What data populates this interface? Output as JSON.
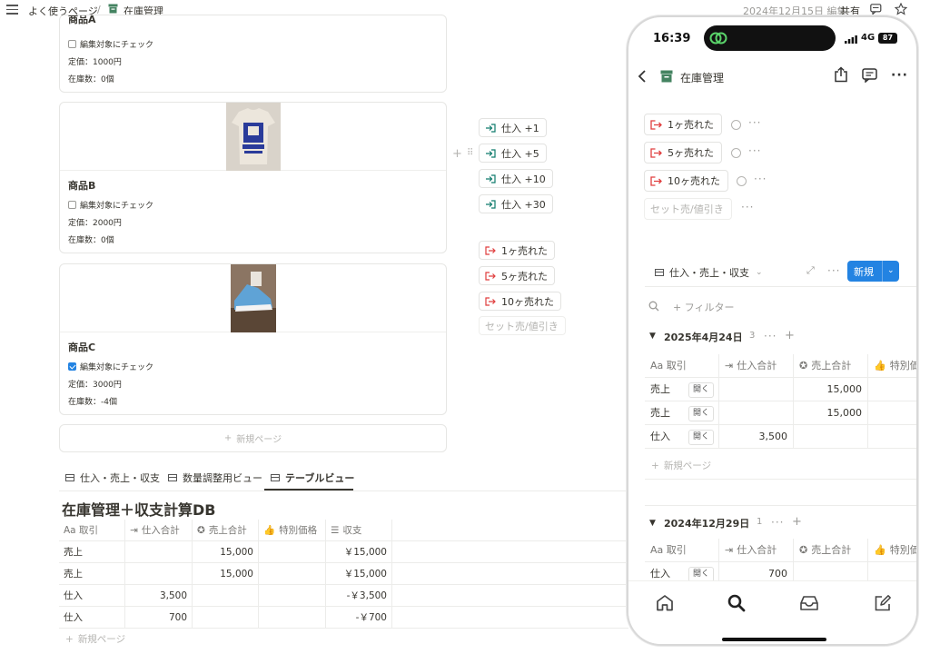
{
  "topbar": {
    "breadcrumb_parent": "よく使うページ",
    "breadcrumb_sep": "/",
    "breadcrumb_current": "在庫管理",
    "edited": "2024年12月15日 編集",
    "share": "共有"
  },
  "cards": [
    {
      "title": "商品A",
      "checkbox_label": "編集対象にチェック",
      "checked": false,
      "price": "定価：1000円",
      "stock": "在庫数：0個"
    },
    {
      "title": "商品B",
      "checkbox_label": "編集対象にチェック",
      "checked": false,
      "price": "定価：2000円",
      "stock": "在庫数：0個"
    },
    {
      "title": "商品C",
      "checkbox_label": "編集対象にチェック",
      "checked": true,
      "price": "定価：3000円",
      "stock": "在庫数：-4個"
    }
  ],
  "new_page": "新規ページ",
  "buy_buttons": [
    "仕入 +1",
    "仕入 +5",
    "仕入 +10",
    "仕入 +30"
  ],
  "sell_buttons": [
    "1ヶ売れた",
    "5ヶ売れた",
    "10ヶ売れた"
  ],
  "set_sale": "セット売/値引き",
  "tabs": [
    "仕入・売上・収支",
    "数量調整用ビュー",
    "テーブルビュー"
  ],
  "db_title": "在庫管理＋収支計算DB",
  "table": {
    "headers": [
      "Aa 取引",
      "仕入合計",
      "売上合計",
      "特別価格",
      "収支"
    ],
    "rows": [
      [
        "売上",
        "",
        "15,000",
        "",
        "￥15,000"
      ],
      [
        "売上",
        "",
        "15,000",
        "",
        "￥15,000"
      ],
      [
        "仕入",
        "3,500",
        "",
        "",
        "-￥3,500"
      ],
      [
        "仕入",
        "700",
        "",
        "",
        "-￥700"
      ]
    ],
    "new_page": "新規ページ"
  },
  "phone": {
    "time": "16:39",
    "signal": "4G",
    "battery": "87",
    "page_title": "在庫管理",
    "sell_buttons": [
      "1ヶ売れた",
      "5ヶ売れた",
      "10ヶ売れた"
    ],
    "set_sale": "セット売/値引き",
    "view_name": "仕入・売上・収支",
    "new_button": "新規",
    "filter": "+ フィルター",
    "group1": {
      "label": "2025年4月24日",
      "count": "3"
    },
    "group2": {
      "label": "2024年12月29日",
      "count": "1"
    },
    "headers": [
      "Aa 取引",
      "仕入合計",
      "売上合計",
      "特別価"
    ],
    "open_label": "開く",
    "rows1": [
      [
        "売上",
        "",
        "15,000"
      ],
      [
        "売上",
        "",
        "15,000"
      ],
      [
        "仕入",
        "3,500",
        ""
      ]
    ],
    "rows2": [
      [
        "仕入",
        "700",
        ""
      ]
    ],
    "new_page": "新規ページ"
  },
  "colors": {
    "accent_blue": "#2383e2",
    "sell_red": "#e03e3e",
    "buy_green": "#0f7b6c",
    "page_icon_green": "#448361"
  }
}
